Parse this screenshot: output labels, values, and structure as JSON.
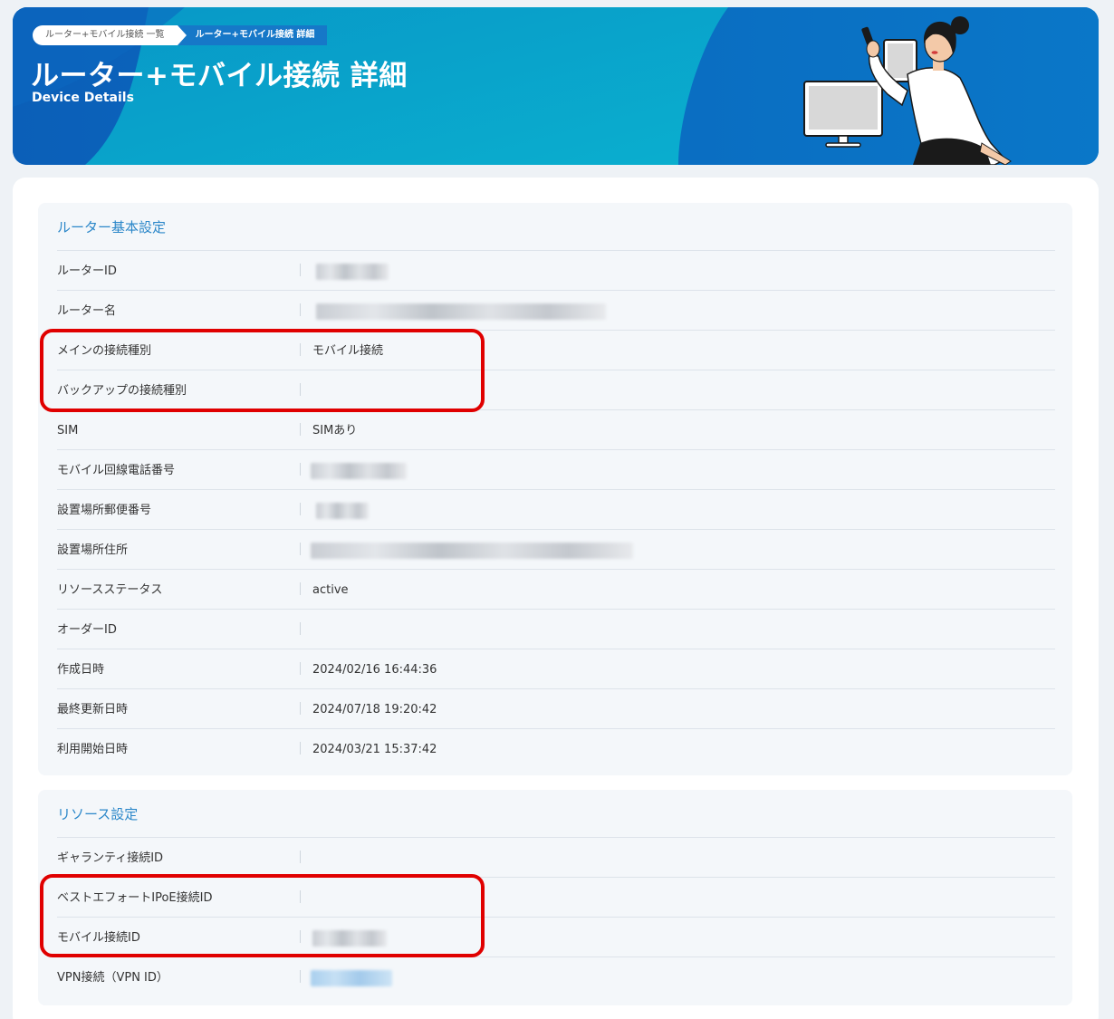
{
  "breadcrumb": {
    "items": [
      "ルーター+モバイル接続 一覧",
      "ルーター+モバイル接続 詳細"
    ]
  },
  "header": {
    "title": "ルーター+モバイル接続 詳細",
    "subtitle": "Device Details"
  },
  "sections": [
    {
      "title": "ルーター基本設定",
      "rows": [
        {
          "label": "ルーターID",
          "value": ""
        },
        {
          "label": "ルーター名",
          "value": ""
        },
        {
          "label": "メインの接続種別",
          "value": "モバイル接続"
        },
        {
          "label": "バックアップの接続種別",
          "value": ""
        },
        {
          "label": "SIM",
          "value": "SIMあり"
        },
        {
          "label": "モバイル回線電話番号",
          "value": ""
        },
        {
          "label": "設置場所郵便番号",
          "value": ""
        },
        {
          "label": "設置場所住所",
          "value": ""
        },
        {
          "label": "リソースステータス",
          "value": "active"
        },
        {
          "label": "オーダーID",
          "value": ""
        },
        {
          "label": "作成日時",
          "value": "2024/02/16 16:44:36"
        },
        {
          "label": "最終更新日時",
          "value": "2024/07/18 19:20:42"
        },
        {
          "label": "利用開始日時",
          "value": "2024/03/21 15:37:42"
        }
      ]
    },
    {
      "title": "リソース設定",
      "rows": [
        {
          "label": "ギャランティ接続ID",
          "value": ""
        },
        {
          "label": "ベストエフォートIPoE接続ID",
          "value": ""
        },
        {
          "label": "モバイル接続ID",
          "value": ""
        },
        {
          "label": "VPN接続（VPN ID）",
          "value": ""
        }
      ]
    }
  ],
  "colors": {
    "banner_blue": "#0a6fc4",
    "banner_cyan": "#0aa3c9",
    "section_title": "#2b87c9",
    "highlight_red": "#e00000"
  }
}
